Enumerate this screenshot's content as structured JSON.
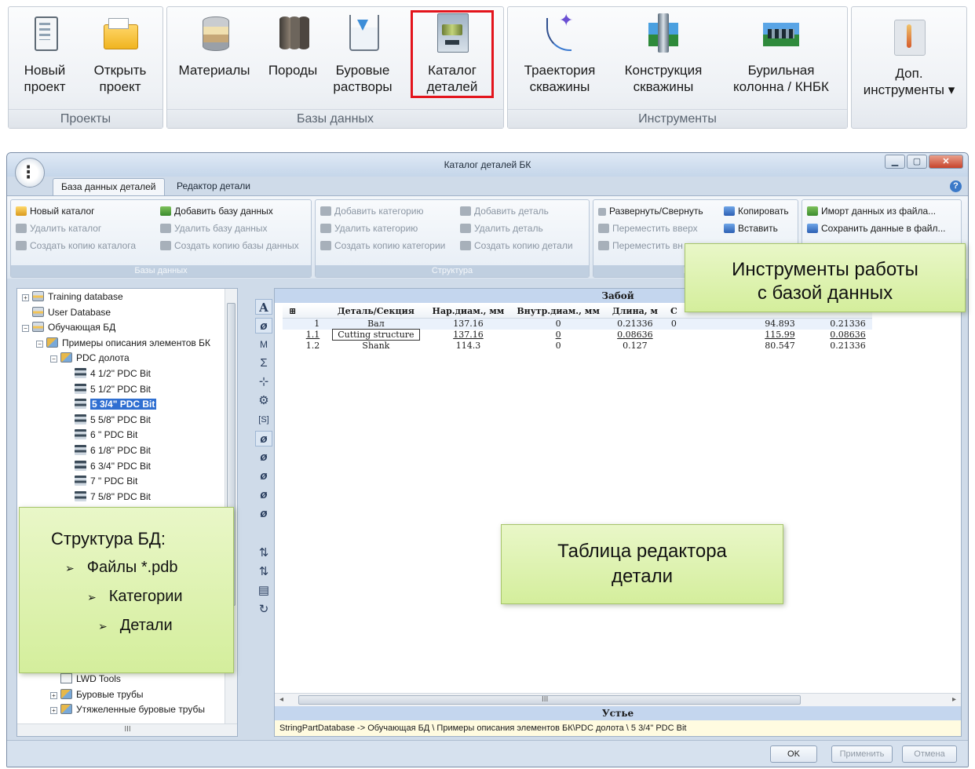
{
  "ribbon": {
    "groups": [
      {
        "caption": "Проекты",
        "buttons": [
          {
            "line1": "Новый",
            "line2": "проект",
            "icon": "new-project-icon"
          },
          {
            "line1": "Открыть",
            "line2": "проект",
            "icon": "open-project-icon"
          }
        ]
      },
      {
        "caption": "Базы данных",
        "buttons": [
          {
            "line1": "Материалы",
            "line2": "",
            "icon": "materials-icon"
          },
          {
            "line1": "Породы",
            "line2": "",
            "icon": "rocks-icon"
          },
          {
            "line1": "Буровые",
            "line2": "растворы",
            "icon": "drilling-fluids-icon"
          },
          {
            "line1": "Каталог",
            "line2": "деталей",
            "icon": "parts-catalog-icon",
            "highlighted": true
          }
        ]
      },
      {
        "caption": "Инструменты",
        "buttons": [
          {
            "line1": "Траектория",
            "line2": "скважины",
            "icon": "trajectory-icon"
          },
          {
            "line1": "Конструкция",
            "line2": "скважины",
            "icon": "well-construction-icon"
          },
          {
            "line1": "Бурильная",
            "line2": "колонна / КНБК",
            "icon": "drill-string-icon"
          }
        ]
      },
      {
        "caption": "",
        "buttons": [
          {
            "line1": "Доп.",
            "line2": "инструменты ▾",
            "icon": "extra-tools-icon"
          }
        ]
      }
    ]
  },
  "window": {
    "title": "Каталог деталей БК",
    "tabs": [
      "База данных деталей",
      "Редактор детали"
    ],
    "toolbar": {
      "db_group": {
        "caption": "Базы данных",
        "items": [
          "Новый каталог",
          "Добавить базу данных",
          "Удалить каталог",
          "Удалить базу данных",
          "Создать копию каталога",
          "Создать копию базы данных"
        ]
      },
      "structure_group": {
        "caption": "Структура",
        "items": [
          "Добавить категорию",
          "Добавить деталь",
          "Удалить категорию",
          "Удалить деталь",
          "Создать копию категории",
          "Создать копию детали"
        ]
      },
      "edit_group": {
        "caption": "Инстр",
        "items": [
          "Развернуть/Свернуть",
          "Копировать",
          "Переместить вверх",
          "Вставить",
          "Переместить вн"
        ]
      },
      "data_group": {
        "items": [
          "Иморт данных из файла...",
          "Сохранить данные в файл..."
        ]
      }
    },
    "tree": [
      {
        "label": "Training database",
        "level": 0,
        "exp": "+",
        "icon": "db"
      },
      {
        "label": "User Database",
        "level": 0,
        "exp": "",
        "icon": "db"
      },
      {
        "label": "Обучающая БД",
        "level": 0,
        "exp": "−",
        "icon": "db"
      },
      {
        "label": "Примеры описания элементов БК",
        "level": 1,
        "exp": "−",
        "icon": "cat"
      },
      {
        "label": "PDC долота",
        "level": 2,
        "exp": "−",
        "icon": "cat"
      },
      {
        "label": "4 1/2\" PDC Bit",
        "level": 3,
        "exp": "",
        "icon": "part"
      },
      {
        "label": "5 1/2\" PDC Bit",
        "level": 3,
        "exp": "",
        "icon": "part"
      },
      {
        "label": "5 3/4\" PDC Bit",
        "level": 3,
        "exp": "",
        "icon": "part",
        "selected": true
      },
      {
        "label": "5 5/8\" PDC Bit",
        "level": 3,
        "exp": "",
        "icon": "part"
      },
      {
        "label": "6 \" PDC Bit",
        "level": 3,
        "exp": "",
        "icon": "part"
      },
      {
        "label": "6 1/8\" PDC Bit",
        "level": 3,
        "exp": "",
        "icon": "part"
      },
      {
        "label": "6 3/4\" PDC Bit",
        "level": 3,
        "exp": "",
        "icon": "part"
      },
      {
        "label": "7 \" PDC Bit",
        "level": 3,
        "exp": "",
        "icon": "part"
      },
      {
        "label": "7 5/8\" PDC Bit",
        "level": 3,
        "exp": "",
        "icon": "part"
      }
    ],
    "tree_bottom": [
      {
        "label": "LWD Tools",
        "level": 2,
        "exp": "",
        "icon": "doc"
      },
      {
        "label": "Буровые трубы",
        "level": 2,
        "exp": "+",
        "icon": "cat"
      },
      {
        "label": "Утяжеленные буровые трубы",
        "level": 2,
        "exp": "+",
        "icon": "cat"
      }
    ],
    "tree_scroll_glyph": "III",
    "editor": {
      "top_band": "Забой",
      "bottom_band": "Устье",
      "path": "StringPartDatabase -> Обучающая БД \\ Примеры описания элементов БК\\PDC долота \\ 5 3/4\" PDC Bit",
      "columns": [
        "⊞",
        "Деталь/Секция",
        "Нар.диам., мм",
        "Внутр.диам., мм",
        "Длина, м",
        "С"
      ],
      "rows": [
        {
          "n": "1",
          "name": "Вал",
          "od": "137.16",
          "id": "0",
          "len": "0.21336",
          "c": "0",
          "x1": "94.893",
          "x2": "0.21336"
        },
        {
          "n": "1.1",
          "name": "Cutting structure",
          "od": "137.16",
          "id": "0",
          "len": "0.08636",
          "c": "",
          "x1": "115.99",
          "x2": "0.08636"
        },
        {
          "n": "1.2",
          "name": "Shank",
          "od": "114.3",
          "id": "0",
          "len": "0.127",
          "c": "",
          "x1": "80.547",
          "x2": "0.21336"
        }
      ],
      "scroll_glyph": "III"
    },
    "buttons": {
      "ok": "OK",
      "apply": "Применить",
      "cancel": "Отмена"
    }
  },
  "callouts": {
    "tools_line1": "Инструменты работы",
    "tools_line2": "с базой данных",
    "structure_title": "Структура БД:",
    "structure_items": [
      "Файлы *.pdb",
      "Категории",
      "Детали"
    ],
    "table_line1": "Таблица редактора",
    "table_line2": "детали"
  }
}
